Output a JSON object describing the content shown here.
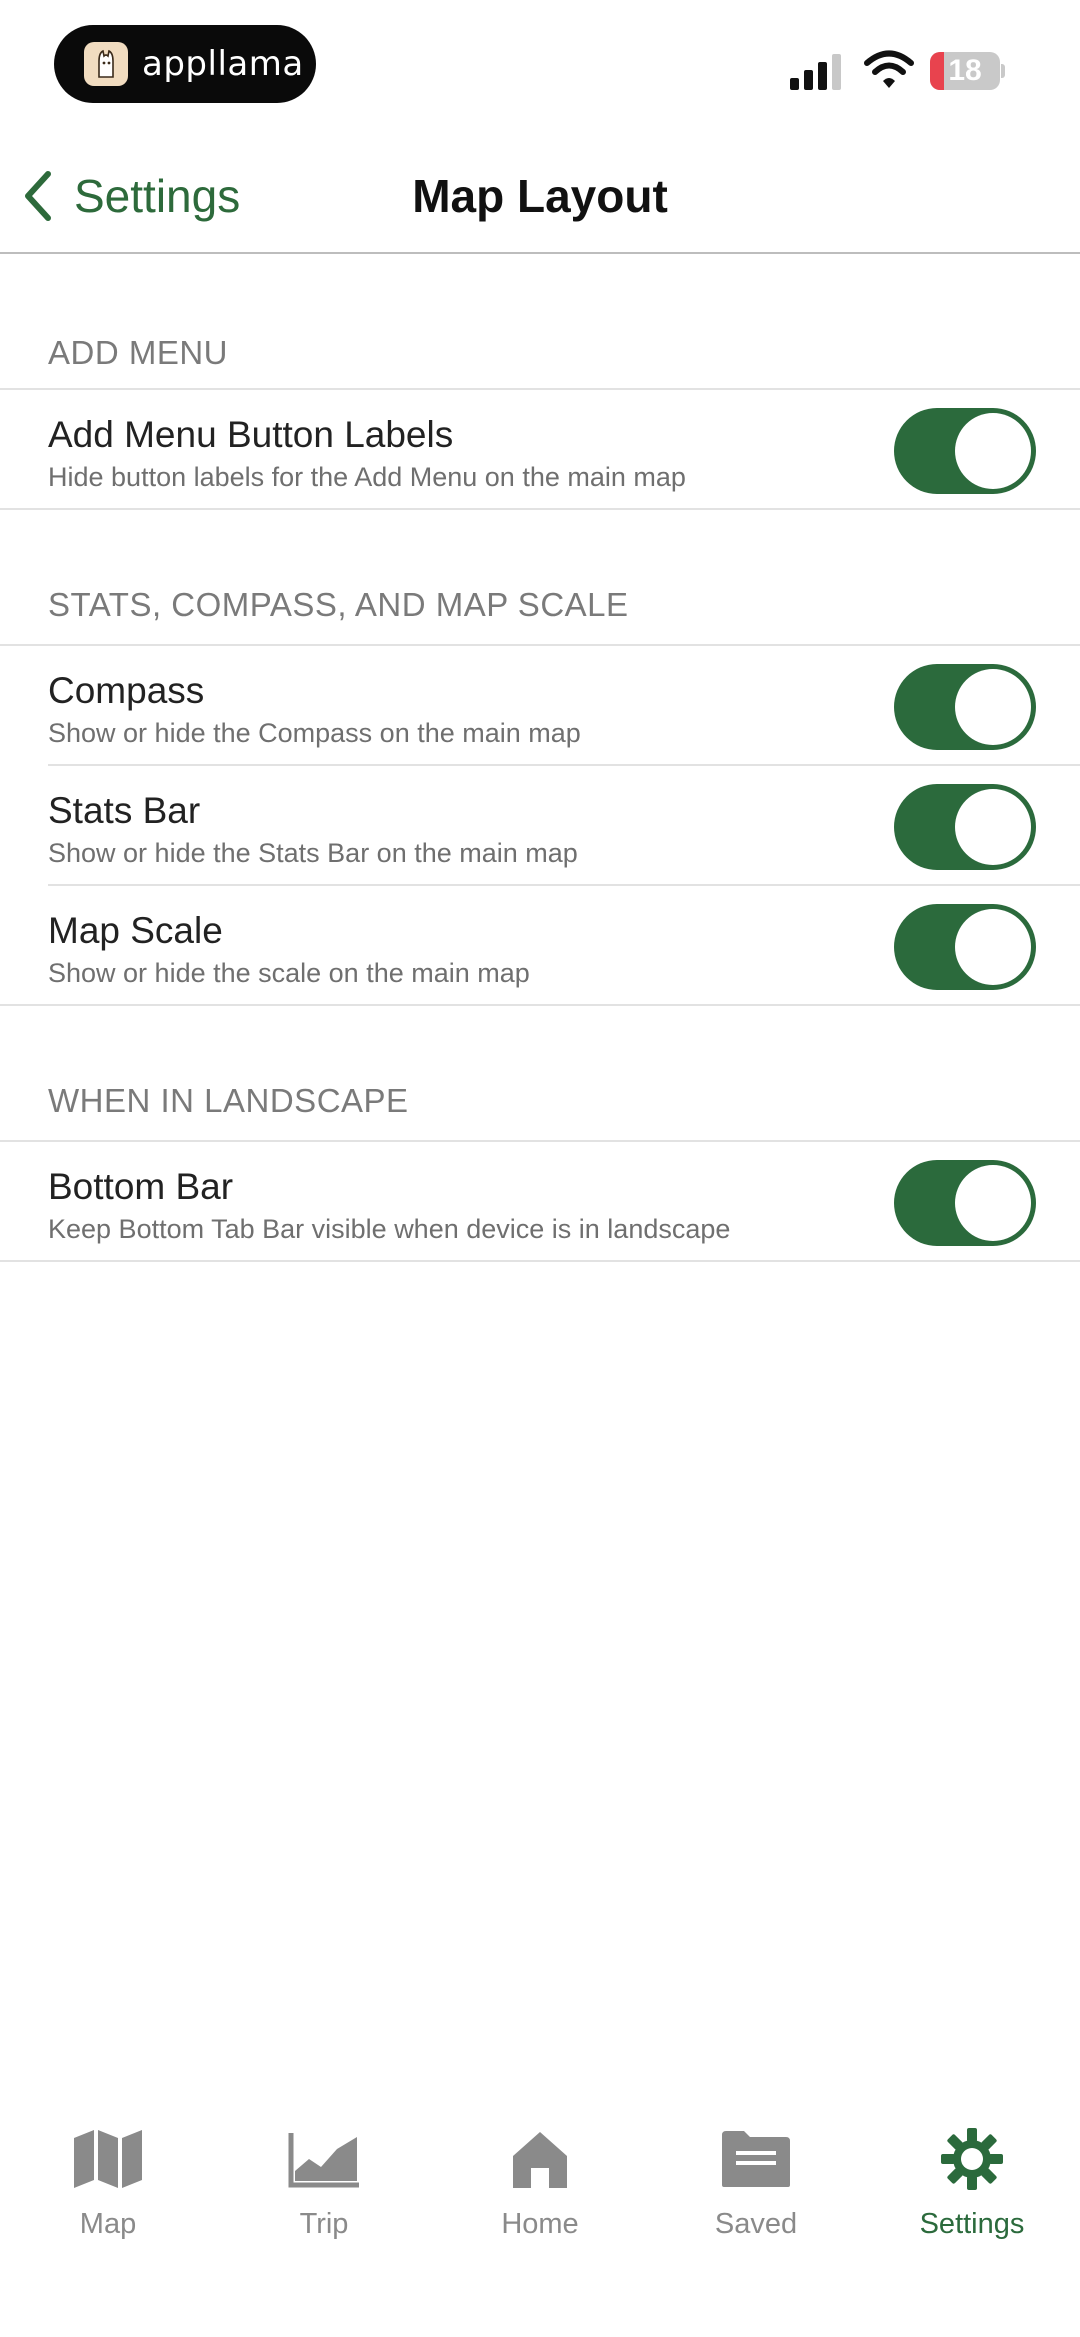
{
  "status_bar": {
    "app_name": "appllama",
    "battery_level": "18",
    "icons": [
      "signal-icon",
      "wifi-icon",
      "battery-icon"
    ]
  },
  "nav": {
    "back_label": "Settings",
    "title": "Map Layout"
  },
  "sections": [
    {
      "header": "ADD MENU",
      "rows": [
        {
          "title": "Add Menu Button Labels",
          "subtitle": "Hide button labels for the Add Menu on the main map",
          "enabled": true
        }
      ]
    },
    {
      "header": "STATS, COMPASS, AND MAP SCALE",
      "rows": [
        {
          "title": "Compass",
          "subtitle": "Show or hide the Compass on the main map",
          "enabled": true
        },
        {
          "title": "Stats Bar",
          "subtitle": "Show or hide the Stats Bar on the main map",
          "enabled": true
        },
        {
          "title": "Map Scale",
          "subtitle": "Show or hide the scale on the main map",
          "enabled": true
        }
      ]
    },
    {
      "header": "WHEN IN LANDSCAPE",
      "rows": [
        {
          "title": "Bottom Bar",
          "subtitle": "Keep Bottom Tab Bar visible when device is in landscape",
          "enabled": true
        }
      ]
    }
  ],
  "tabs": [
    {
      "label": "Map",
      "icon": "map-icon",
      "active": false
    },
    {
      "label": "Trip",
      "icon": "chart-icon",
      "active": false
    },
    {
      "label": "Home",
      "icon": "home-icon",
      "active": false
    },
    {
      "label": "Saved",
      "icon": "folder-icon",
      "active": false
    },
    {
      "label": "Settings",
      "icon": "gear-icon",
      "active": true
    }
  ],
  "colors": {
    "accent": "#2b6a3c",
    "inactive_tab": "#8a8a8a",
    "battery_low": "#e8434e"
  }
}
